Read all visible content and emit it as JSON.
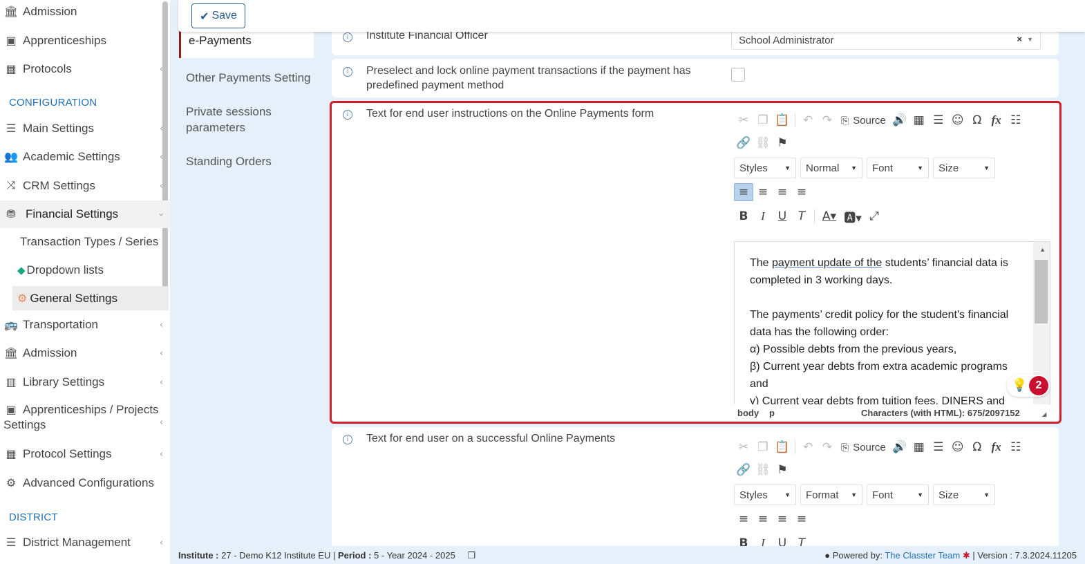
{
  "sidebar": {
    "items": [
      {
        "label": "Admission",
        "icon": "institution-icon"
      },
      {
        "label": "Apprenticeships",
        "icon": "box-icon"
      },
      {
        "label": "Protocols",
        "icon": "calendar-icon"
      }
    ],
    "configuration_header": "CONFIGURATION",
    "config_items": [
      {
        "label": "Main Settings",
        "icon": "sliders-icon"
      },
      {
        "label": "Academic Settings",
        "icon": "users-icon"
      },
      {
        "label": "CRM Settings",
        "icon": "shuffle-icon"
      },
      {
        "label": "Financial Settings",
        "icon": "coins-icon"
      }
    ],
    "financial_sub": [
      {
        "label": "Transaction Types / Series"
      },
      {
        "label": "Dropdown lists"
      },
      {
        "label": "General Settings"
      }
    ],
    "more_items": [
      {
        "label": "Transportation",
        "icon": "bus-icon"
      },
      {
        "label": "Admission",
        "icon": "institution-icon"
      },
      {
        "label": "Library Settings",
        "icon": "books-icon"
      },
      {
        "label": "Apprenticeships / Projects",
        "label2": "Settings",
        "icon": "box-icon"
      },
      {
        "label": "Protocol Settings",
        "icon": "calendar-icon"
      },
      {
        "label": "Advanced Configurations",
        "icon": "gears-icon"
      }
    ],
    "district_header": "DISTRICT",
    "district_items": [
      {
        "label": "District Management",
        "icon": "list-icon"
      }
    ]
  },
  "toolbar": {
    "save_label": "Save"
  },
  "tabs": {
    "active": "e-Payments",
    "other": [
      "Other Payments Setting",
      "Private sessions",
      "parameters",
      "Standing Orders"
    ]
  },
  "fields": {
    "officer_label": "Institute Financial Officer",
    "officer_value": "School Administrator",
    "preselect_line1": "Preselect and lock online payment transactions if the payment has",
    "preselect_line2": "predefined payment method",
    "instructions_label": "Text for end user instructions on the Online Payments form",
    "success_label": "Text for end user on a successful Online Payments"
  },
  "editor": {
    "source_label": "Source",
    "styles": "Styles",
    "normal": "Normal",
    "format": "Format",
    "font": "Font",
    "size": "Size",
    "content": {
      "p1_before": "The ",
      "p1_underlined": "payment update of the",
      "p1_after": " students’ financial data is completed in 3 working days.",
      "p2": "The payments’ credit policy for the student's financial data has the following order:",
      "l1": " α) Possible debts from the previous years,",
      "l2": " β) Current year debts from extra academic programs and",
      "l3": " γ) Current year debts from tuition fees, DINERS and"
    },
    "path_body": "body",
    "path_p": "p",
    "char_count": "Characters (with HTML): 675/2097152"
  },
  "badge": {
    "count": "2"
  },
  "footer": {
    "institute_label": "Institute :",
    "institute_value": "27 - Demo K12 Institute EU",
    "period_label": "Period :",
    "period_value": "5 - Year 2024 - 2025",
    "powered_by": "Powered by:",
    "powered_link": "The Classter Team",
    "version_label": "Version :",
    "version_value": "7.3.2024.11205"
  },
  "colors": {
    "accent": "#1f6fb5",
    "highlight": "#d01f2a",
    "active_tab_border": "#9b1b1b",
    "badge": "#c8102e"
  }
}
